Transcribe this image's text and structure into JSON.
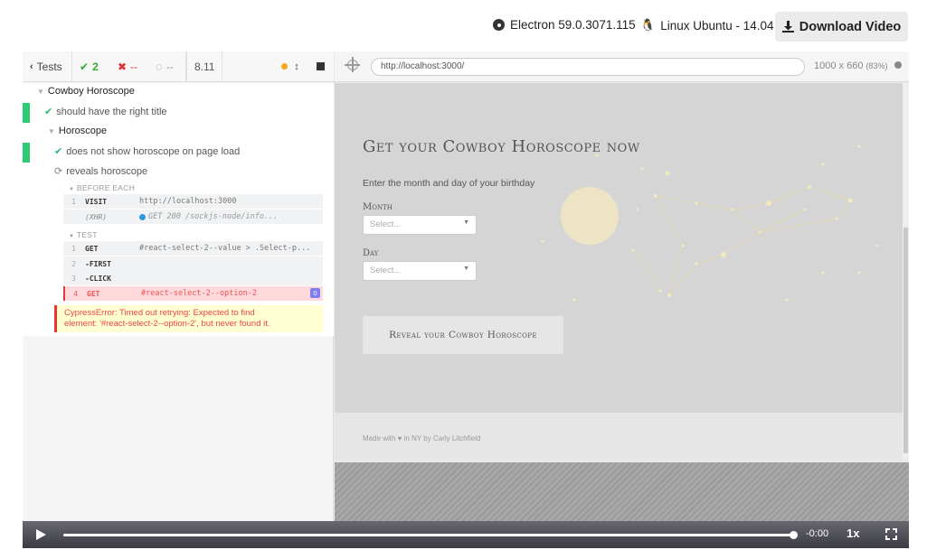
{
  "topbar": {
    "electron_label": "Electron 59.0.3071.115",
    "linux_label": "Linux Ubuntu - 14.04",
    "download_label": "Download Video"
  },
  "reporter": {
    "header": {
      "tests_label": "Tests",
      "passed": "2",
      "failed": "--",
      "pending": "--",
      "duration": "8.11"
    },
    "suite": "Cowboy Horoscope",
    "test1": "should have the right title",
    "subsuite": "Horoscope",
    "test2": "does not show horoscope on page load",
    "test3": "reveals horoscope",
    "before_each_label": "BEFORE EACH",
    "test_label": "TEST",
    "before_each_cmds": [
      {
        "num": "1",
        "name": "VISIT",
        "msg": "http://localhost:3000"
      },
      {
        "num": "",
        "name": "(XHR)",
        "msg": "GET 200 /sockjs-node/info..."
      }
    ],
    "test_cmds": [
      {
        "num": "1",
        "name": "GET",
        "msg": "#react-select-2--value > .Select-p..."
      },
      {
        "num": "2",
        "name": "-FIRST",
        "msg": ""
      },
      {
        "num": "3",
        "name": "-CLICK",
        "msg": ""
      },
      {
        "num": "4",
        "name": "GET",
        "msg": "#react-select-2--option-2",
        "badge": "0"
      }
    ],
    "error_line1": "CypressError: Timed out retrying: Expected to find",
    "error_line2": "element: '#react-select-2--option-2', but never found it."
  },
  "aut": {
    "url": "http://localhost:3000/",
    "viewport": "1000 x 660",
    "scale": "(83%)",
    "page": {
      "title": "Get your Cowboy Horoscope now",
      "subtitle": "Enter the month and day of your birthday",
      "month_label": "Month",
      "day_label": "Day",
      "select_placeholder": "Select...",
      "reveal_button": "Reveal your Cowboy Horoscope",
      "footer": "Made with ♥ in NY by Carly Litchfield"
    }
  },
  "controls": {
    "time": "-0:00",
    "speed": "1x",
    "progress": 1.0
  }
}
